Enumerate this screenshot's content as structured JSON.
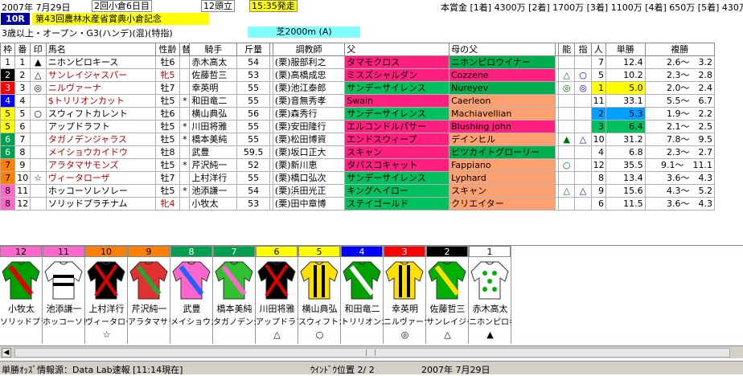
{
  "header": {
    "date": "2007年 7月29日",
    "meeting": "2回小倉6日目",
    "runners": "12頭立",
    "post_time": "15:35発走",
    "prize": "本賞金 [1着] 4300万 [2着] 1700万 [3着] 1100万 [4着] 650万 [5着] 430万"
  },
  "race": {
    "no": "10R",
    "name": "第43回農林水産省賞典小倉記念",
    "conditions": "3歳以上・オープン・G3(ハンデ)(混)(特指)",
    "track": "芝2000m (A)"
  },
  "columns": [
    "枠",
    "番",
    "印",
    "馬名",
    "性齢",
    "替",
    "騎手",
    "斤量",
    "",
    "調教師",
    "父",
    "",
    "母の父",
    "",
    "能",
    "指",
    "人",
    "単勝",
    "複勝"
  ],
  "rows": [
    {
      "w": "1",
      "n": "1",
      "mk": "▲",
      "name": "ニホンピロキース",
      "sa": "牡6",
      "chg": "",
      "jockey": "赤木高太",
      "kg": "54",
      "stb": "(栗)",
      "trainer": "服部利之",
      "sire": "タマモクロス",
      "sire_bg": "#ff1f7f",
      "dam": "ニホンピロウイナー",
      "dam_bg": "#00b050",
      "nou": "",
      "shi": "",
      "pop": "7",
      "win": "12.4",
      "pl": "2.6～　3.2",
      "win_class": "",
      "pop_class": ""
    },
    {
      "w": "2",
      "n": "2",
      "mk": "△",
      "name": "サンレイジャスパー",
      "sa": "牝5",
      "chg": "",
      "jockey": "佐藤哲三",
      "kg": "53",
      "stb": "(栗)",
      "trainer": "高橋成忠",
      "sire": "ミスズシャルダン",
      "sire_bg": "#ff1f7f",
      "dam": "Cozzene",
      "dam_bg": "#ff1f7f",
      "nou": "△",
      "shi": "○",
      "pop": "5",
      "win": "10.2",
      "pl": "2.3～　2.8",
      "win_class": "",
      "pop_class": ""
    },
    {
      "w": "3",
      "n": "3",
      "mk": "◎",
      "name": "ニルヴァーナ",
      "sa": "牡7",
      "chg": "",
      "jockey": "幸英明",
      "kg": "55",
      "stb": "(栗)",
      "trainer": "池江泰郎",
      "sire": "サンデーサイレンス",
      "sire_bg": "#00c060",
      "dam": "Nureyev",
      "dam_bg": "#00b050",
      "nou": "◎",
      "shi": "◎",
      "pop": "1",
      "win": "5.0",
      "pl": "2.0～　2.4",
      "win_class": "rank1",
      "pop_class": "rank1"
    },
    {
      "w": "4",
      "n": "4",
      "mk": "",
      "name": "$トリリオンカット",
      "sa": "牡5",
      "chg": "*",
      "jockey": "和田竜二",
      "kg": "55",
      "stb": "(栗)",
      "trainer": "音無秀孝",
      "sire": "Swain",
      "sire_bg": "#ff1f7f",
      "dam": "Caerleon",
      "dam_bg": "#ffa070",
      "nou": "",
      "shi": "",
      "pop": "11",
      "win": "33.1",
      "pl": "5.5～　6.7",
      "win_class": "",
      "pop_class": ""
    },
    {
      "w": "5",
      "n": "5",
      "mk": "○",
      "name": "スウィフトカレント",
      "sa": "牡6",
      "chg": "",
      "jockey": "横山典弘",
      "kg": "56",
      "stb": "(栗)",
      "trainer": "森秀行",
      "sire": "サンデーサイレンス",
      "sire_bg": "#00c060",
      "dam": "Machiavellian",
      "dam_bg": "#ffa070",
      "nou": "",
      "shi": "",
      "pop": "2",
      "win": "5.3",
      "pl": "1.9～　2.2",
      "win_class": "rank3",
      "pop_class": "rank3"
    },
    {
      "w": "5",
      "n": "6",
      "mk": "",
      "name": "アップドラフト",
      "sa": "牡5",
      "chg": "*",
      "jockey": "川田将雅",
      "kg": "55",
      "stb": "(栗)",
      "trainer": "安田隆行",
      "sire": "エルコンドルパサー",
      "sire_bg": "#ff1f7f",
      "dam": "Blushing John",
      "dam_bg": "#ff1f7f",
      "nou": "",
      "shi": "",
      "pop": "3",
      "win": "6.4",
      "pl": "2.1～　2.5",
      "win_class": "rank2",
      "pop_class": "rank2"
    },
    {
      "w": "6",
      "n": "7",
      "mk": "",
      "name": "タガノデンジャラス",
      "sa": "牡5",
      "chg": "*",
      "jockey": "橋本美純",
      "kg": "55",
      "stb": "(栗)",
      "trainer": "松田博資",
      "sire": "エンドスウィープ",
      "sire_bg": "#ff1f7f",
      "dam": "デインヒル",
      "dam_bg": "#ffa070",
      "nou": "▲",
      "shi": "△",
      "pop": "10",
      "win": "31.2",
      "pl": "7.8～　9.5",
      "win_class": "",
      "pop_class": ""
    },
    {
      "w": "6",
      "n": "8",
      "mk": "",
      "name": "メイショウカイドウ",
      "sa": "牡8",
      "chg": "",
      "jockey": "武豊",
      "kg": "59.5",
      "stb": "(栗)",
      "trainer": "坂口正大",
      "sire": "スキャン",
      "sire_bg": "#ff1f7f",
      "dam": "ピツカイトグローリー",
      "dam_bg": "#00b050",
      "nou": "",
      "shi": "",
      "pop": "4",
      "win": "6.8",
      "pl": "2.3～　2.7",
      "win_class": "",
      "pop_class": ""
    },
    {
      "w": "7",
      "n": "9",
      "mk": "",
      "name": "アラタマサモンズ",
      "sa": "牡5",
      "chg": "*",
      "jockey": "芹沢純一",
      "kg": "52",
      "stb": "(栗)",
      "trainer": "新川恵",
      "sire": "タバスコキャット",
      "sire_bg": "#ff1f7f",
      "dam": "Fappiano",
      "dam_bg": "#ffa070",
      "nou": "○",
      "shi": "",
      "pop": "12",
      "win": "35.5",
      "pl": "9.1～　11.1",
      "win_class": "",
      "pop_class": ""
    },
    {
      "w": "7",
      "n": "10",
      "mk": "☆",
      "name": "ヴィータローザ",
      "sa": "牡7",
      "chg": "",
      "jockey": "上村洋行",
      "kg": "55",
      "stb": "(栗)",
      "trainer": "橋口弘次",
      "sire": "サンデーサイレンス",
      "sire_bg": "#00c060",
      "dam": "Lyphard",
      "dam_bg": "#ffa070",
      "nou": "",
      "shi": "",
      "pop": "8",
      "win": "13.4",
      "pl": "3.6～　4.3",
      "win_class": "",
      "pop_class": ""
    },
    {
      "w": "8",
      "n": "11",
      "mk": "",
      "name": "ホッコーソレソレー",
      "sa": "牡5",
      "chg": "*",
      "jockey": "池添謙一",
      "kg": "54",
      "stb": "(栗)",
      "trainer": "浜田光正",
      "sire": "キングヘイロー",
      "sire_bg": "#00c060",
      "dam": "スキャン",
      "dam_bg": "#ffa070",
      "nou": "△",
      "shi": "△",
      "pop": "9",
      "win": "15.6",
      "pl": "4.3～　5.2",
      "win_class": "",
      "pop_class": ""
    },
    {
      "w": "8",
      "n": "12",
      "mk": "",
      "name": "ソリッドプラチナム",
      "sa": "牝4",
      "chg": "",
      "jockey": "小牧太",
      "kg": "53",
      "stb": "(栗)",
      "trainer": "田中章博",
      "sire": "ステイゴールド",
      "sire_bg": "#00c060",
      "dam": "クリエイター",
      "dam_bg": "#ffa070",
      "nou": "",
      "shi": "",
      "pop": "6",
      "win": "11.5",
      "pl": "3.6～　4.3",
      "win_class": "",
      "pop_class": ""
    }
  ],
  "waku_colors": {
    "1": "#ffffff",
    "2": "#000000",
    "3": "#ff0000",
    "4": "#0000ff",
    "5": "#ffff00",
    "6": "#00a050",
    "7": "#ff8000",
    "8": "#ff66cc"
  },
  "silks": [
    {
      "num": "12",
      "num_bg": "#ff66cc",
      "jockey": "小牧太",
      "horse": "ソリッドプラチ",
      "mark": "",
      "icon": "silk-red-green"
    },
    {
      "num": "11",
      "num_bg": "#ff66cc",
      "jockey": "池添謙一",
      "horse": "ホッコーソレソ",
      "mark": "",
      "icon": "silk-white-black"
    },
    {
      "num": "10",
      "num_bg": "#ff8000",
      "jockey": "上村洋行",
      "horse": "ヴィータロー",
      "mark": "☆",
      "icon": "silk-black-red-x"
    },
    {
      "num": "9",
      "num_bg": "#ff8000",
      "jockey": "芹沢純一",
      "horse": "アラタマサモ",
      "mark": "",
      "icon": "silk-red-green-check"
    },
    {
      "num": "8",
      "num_bg": "#00a050",
      "jockey": "武豊",
      "horse": "メイショウカイ",
      "mark": "",
      "icon": "silk-pink-blue"
    },
    {
      "num": "7",
      "num_bg": "#00a050",
      "jockey": "橋本美純",
      "horse": "タガノデンジ",
      "mark": "",
      "icon": "silk-green-pink"
    },
    {
      "num": "6",
      "num_bg": "#ffff00",
      "jockey": "川田将雅",
      "horse": "アップドラフト",
      "mark": "△",
      "icon": "silk-black-red-x"
    },
    {
      "num": "5",
      "num_bg": "#ffff00",
      "jockey": "横山典弘",
      "horse": "スウィフトカ",
      "mark": "○",
      "icon": "silk-yellow-black"
    },
    {
      "num": "4",
      "num_bg": "#0000ff",
      "jockey": "和田竜二",
      "horse": "トリリオンカッ",
      "mark": "",
      "icon": "silk-green-white"
    },
    {
      "num": "3",
      "num_bg": "#ff0000",
      "jockey": "幸英明",
      "horse": "ニルヴァーナ",
      "mark": "◎",
      "icon": "silk-yellow-black-stripe"
    },
    {
      "num": "2",
      "num_bg": "#000000",
      "jockey": "佐藤哲三",
      "horse": "サンレイジャ",
      "mark": "△",
      "icon": "silk-green-yellow"
    },
    {
      "num": "1",
      "num_bg": "#ffffff",
      "jockey": "赤木高太",
      "horse": "ニホンピロキ",
      "mark": "▲",
      "icon": "silk-white-green-dots"
    }
  ],
  "status": {
    "source": "単勝ｵｯｽﾞ情報源：Data Lab速報 [11:14現在]",
    "window": "ｳｲﾝﾄﾞｳ位置 2/ 2",
    "date": "2007年 7月29日"
  }
}
